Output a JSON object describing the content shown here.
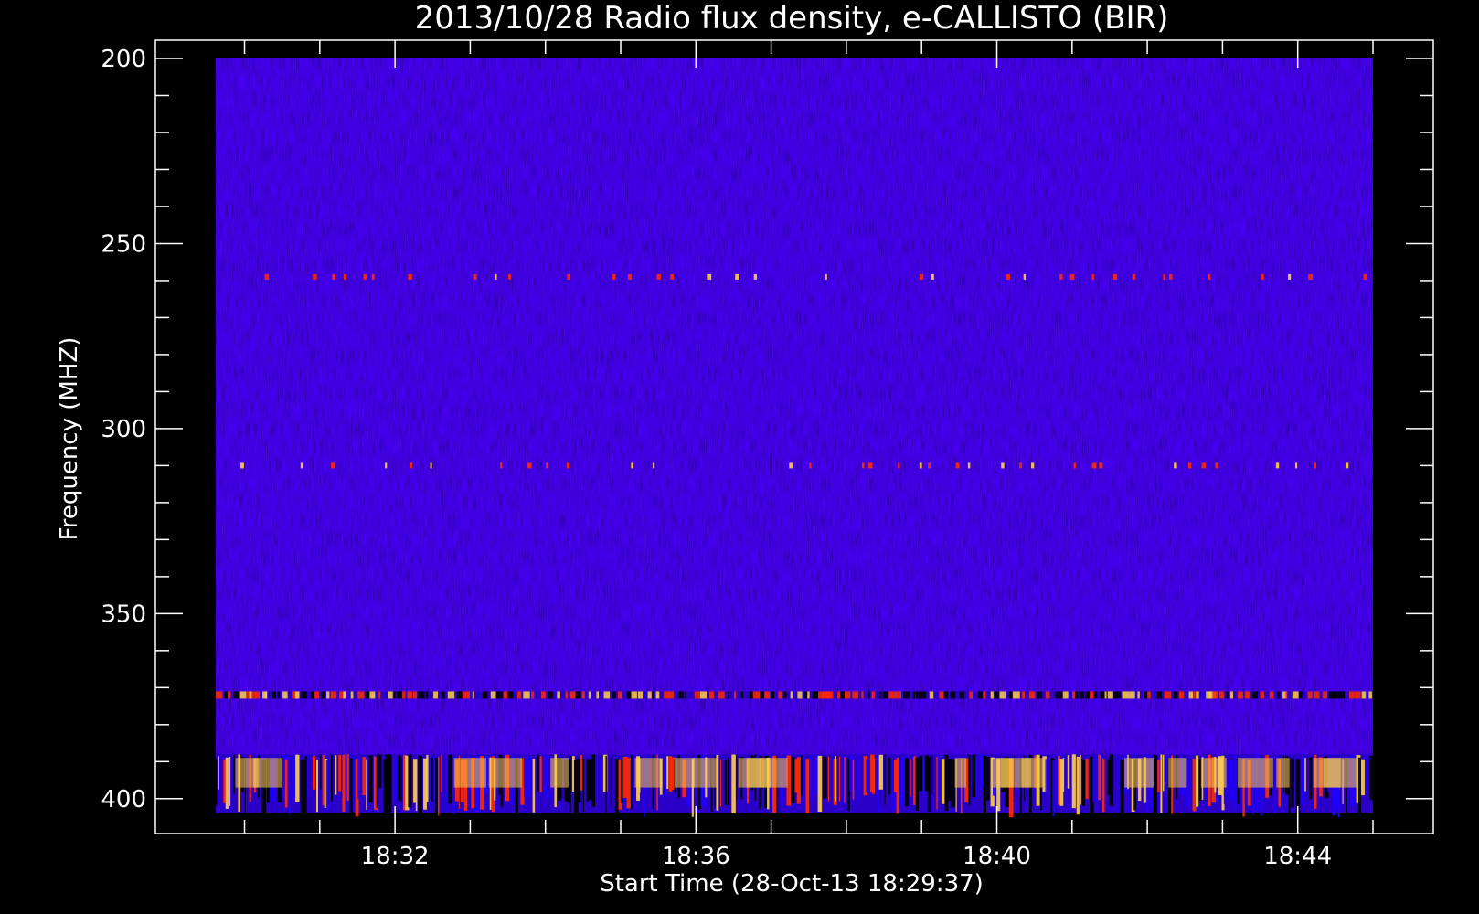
{
  "chart_data": {
    "type": "heatmap",
    "title": "2013/10/28  Radio flux density, e-CALLISTO (BIR)",
    "xlabel": "Start Time (28-Oct-13 18:29:37)",
    "ylabel": "Frequency (MHZ)",
    "x_ticks": [
      "18:32",
      "18:36",
      "18:40",
      "18:44"
    ],
    "x_tick_minutes": [
      32,
      36,
      40,
      44
    ],
    "x_range_minutes": [
      29.617,
      45
    ],
    "y_ticks": [
      200,
      250,
      300,
      350,
      400
    ],
    "y_range": [
      200,
      404
    ],
    "y_inverted": true,
    "colormap": [
      "#000000",
      "#2a00c8",
      "#1e00ff",
      "#ff2a00",
      "#ffd04a"
    ],
    "features": [
      {
        "frequency_mhz": 259,
        "kind": "intermittent interference line"
      },
      {
        "frequency_mhz": 310,
        "kind": "intermittent interference line"
      },
      {
        "frequency_mhz": 372,
        "kind": "interference band"
      },
      {
        "frequency_mhz_range": [
          388,
          404
        ],
        "kind": "strong interference band"
      }
    ]
  }
}
